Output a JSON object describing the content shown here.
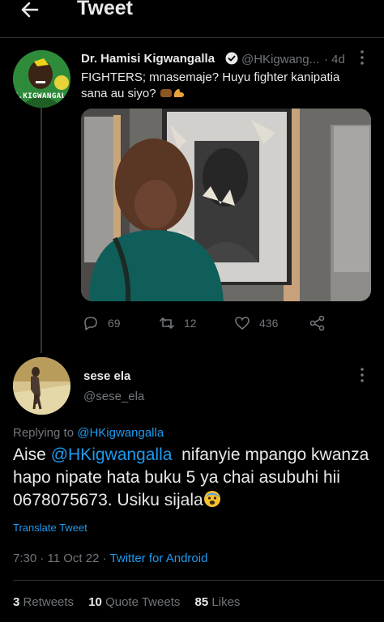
{
  "header": {
    "title": "Tweet"
  },
  "original_tweet": {
    "author_name": "Dr. Hamisi Kigwangalla",
    "author_handle": "@HKigwang...",
    "time": "· 4d",
    "text": "FIGHTERS; mnasemaje? Huyu fighter kanipatia sana au siyo?",
    "avatar_caption": "H.KIGWANGALI",
    "stats": {
      "replies": "69",
      "retweets": "12",
      "likes": "436"
    }
  },
  "reply": {
    "author_name": "sese ela",
    "author_handle": "@sese_ela",
    "replying_to_prefix": "Replying to",
    "replying_to_handle": "@HKigwangalla",
    "mention": "@HKigwangalla",
    "text_before_mention": "Aise",
    "text_after_mention": "nifanyie mpango kwanza hapo nipate hata buku 5 ya chai asubuhi hii 0678075673. Usiku sijala",
    "translate": "Translate Tweet",
    "timestamp": "7:30 · 11 Oct 22 ·",
    "source": "Twitter for Android",
    "retweets_count": "3",
    "retweets_label": "Retweets",
    "quote_count": "10",
    "quote_label": "Quote Tweets",
    "likes_count": "85",
    "likes_label": "Likes"
  },
  "colors": {
    "accent": "#1d9bf0",
    "muted": "#71767b",
    "text": "#e7e9ea",
    "background": "#000000"
  },
  "icons": [
    "back-arrow-icon",
    "verified-badge-icon",
    "more-icon",
    "reply-icon",
    "retweet-icon",
    "like-icon",
    "share-icon"
  ]
}
